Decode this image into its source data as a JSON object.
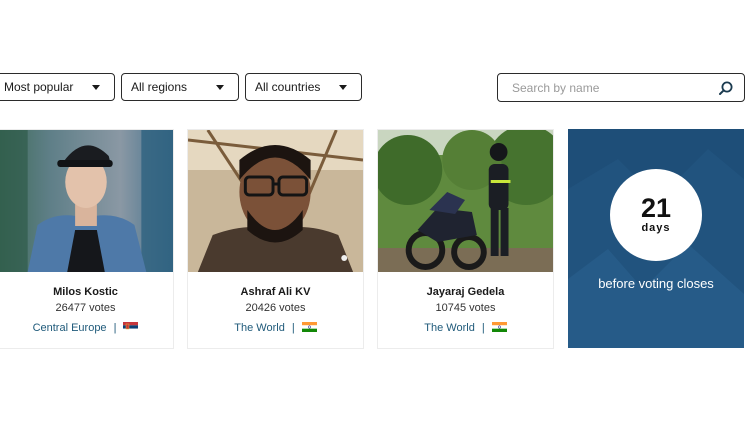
{
  "filters": {
    "sort": "Most popular",
    "region": "All regions",
    "country": "All countries"
  },
  "search": {
    "placeholder": "Search by name",
    "icon": "search-icon"
  },
  "cards": [
    {
      "name": "Milos Kostic",
      "votes": "26477 votes",
      "location": "Central Europe",
      "separator": "|",
      "flag": "serbia-flag"
    },
    {
      "name": "Ashraf Ali KV",
      "votes": "20426 votes",
      "location": "The World",
      "separator": "|",
      "flag": "india-flag"
    },
    {
      "name": "Jayaraj Gedela",
      "votes": "10745 votes",
      "location": "The World",
      "separator": "|",
      "flag": "india-flag"
    }
  ],
  "countdown": {
    "number": "21",
    "unit": "days",
    "message": "before voting closes"
  },
  "colors": {
    "link": "#1f5a7a",
    "countdown_bg": "#21537e"
  }
}
